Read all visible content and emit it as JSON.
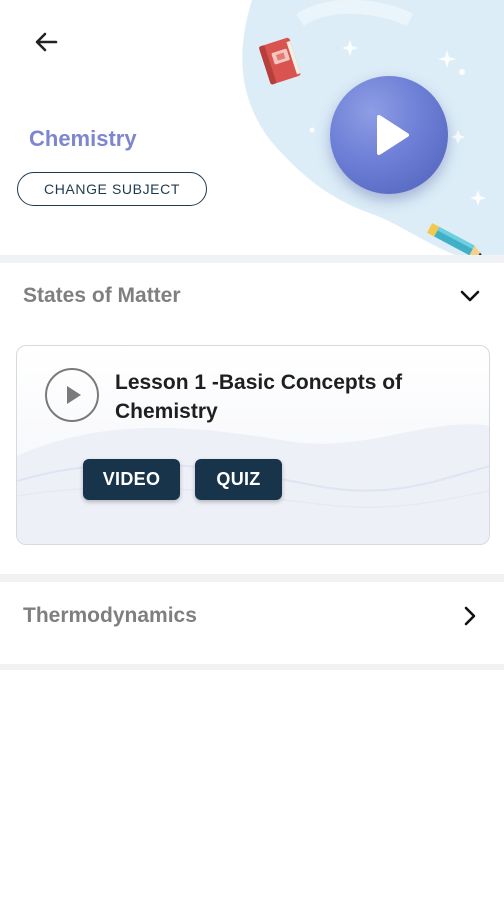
{
  "header": {
    "subject_title": "Chemistry",
    "change_subject_label": "CHANGE SUBJECT"
  },
  "sections": [
    {
      "label": "States of Matter",
      "expanded": true,
      "lessons": [
        {
          "title": "Lesson 1 -Basic Concepts of Chemistry",
          "video_label": "VIDEO",
          "quiz_label": "QUIZ"
        }
      ]
    },
    {
      "label": "Thermodynamics",
      "expanded": false
    }
  ],
  "icons": {
    "back": "arrow-left-icon",
    "play_hero": "play-icon",
    "book": "book-icon",
    "pencil": "pencil-icon",
    "expand": "chevron-down-icon",
    "collapse": "chevron-right-icon"
  },
  "colors": {
    "accent_text": "#7d86cf",
    "button_dark": "#17344a",
    "hero_blob": "#dcedf7",
    "play_hero": "#6d7fd6"
  }
}
